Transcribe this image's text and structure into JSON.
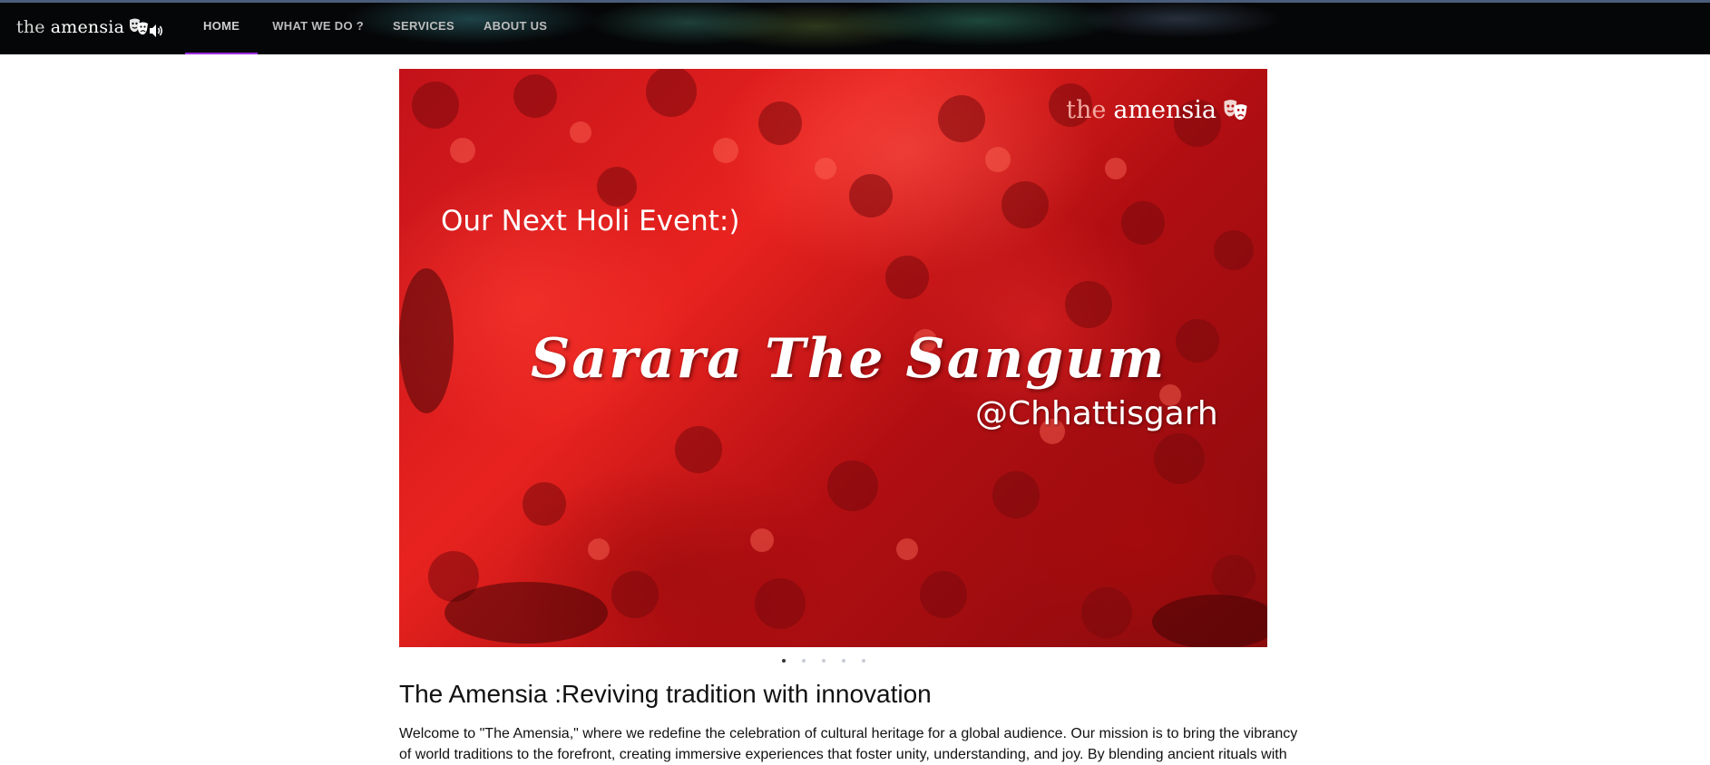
{
  "header": {
    "brand_the": "the",
    "brand_name": "amensia",
    "nav": [
      {
        "label": "HOME",
        "active": true
      },
      {
        "label": "WHAT WE DO ?",
        "active": false
      },
      {
        "label": "SERVICES",
        "active": false
      },
      {
        "label": "ABOUT US",
        "active": false
      }
    ],
    "accent_color": "#9b2ee0"
  },
  "hero": {
    "logo_the": "the",
    "logo_name": "amensia",
    "subtitle": "Our Next Holi Event:)",
    "title": "Sarara The Sangum",
    "location": "@Chhattisgarh",
    "slide_count": 5,
    "active_slide": 1
  },
  "content": {
    "headline": "The Amensia :Reviving tradition with innovation",
    "intro": "Welcome to \"The Amensia,\" where we redefine the celebration of cultural heritage for a global audience. Our mission is to bring the vibrancy of world traditions to the forefront, creating immersive experiences that foster unity, understanding, and joy. By blending ancient rituals with"
  }
}
